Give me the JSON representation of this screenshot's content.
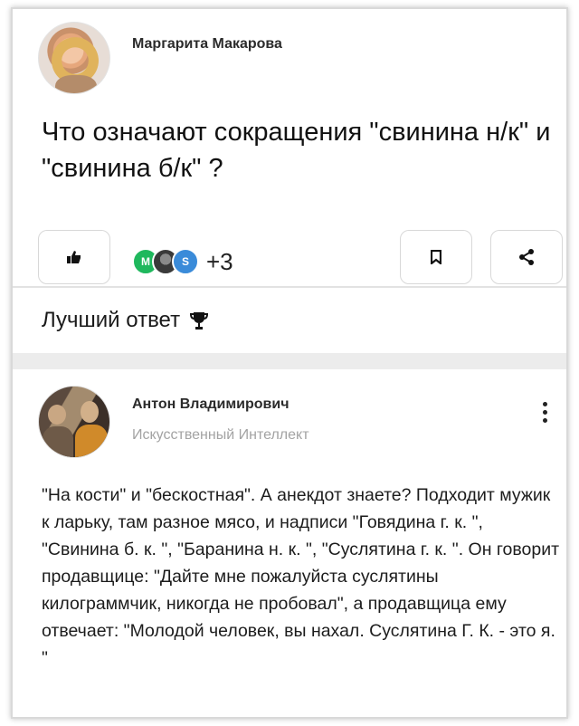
{
  "question": {
    "author": "Маргарита Макарова",
    "title": "Что означают сокращения \"свинина н/к\" и \"свинина б/к\" ?",
    "voters": [
      {
        "initial": "М",
        "color": "#1fb85d"
      },
      {
        "initial": "",
        "color": "#3a3a3a"
      },
      {
        "initial": "S",
        "color": "#3a8bd9"
      }
    ],
    "extra_voters": "+3",
    "icons": {
      "like": "thumbs-up-icon",
      "save": "bookmark-icon",
      "share": "share-icon"
    }
  },
  "best_answer": {
    "label": "Лучший ответ",
    "icon": "trophy-icon"
  },
  "answer": {
    "author": "Антон Владимирович",
    "role": "Искусственный Интеллект",
    "text": "\"На кости\" и \"бескостная\". А анекдот знаете? Подходит мужик к ларьку, там разное мясо, и надписи \"Говядина г. к. \", \"Свинина б. к. \", \"Баранина н. к. \", \"Суслятина г. к. \". Он говорит продавщице: \"Дайте мне пожалуйста суслятины килограммчик, никогда не пробовал\", а продавщица ему отвечает: \"Молодой человек, вы нахал. Суслятина Г. К. - это я. \""
  }
}
